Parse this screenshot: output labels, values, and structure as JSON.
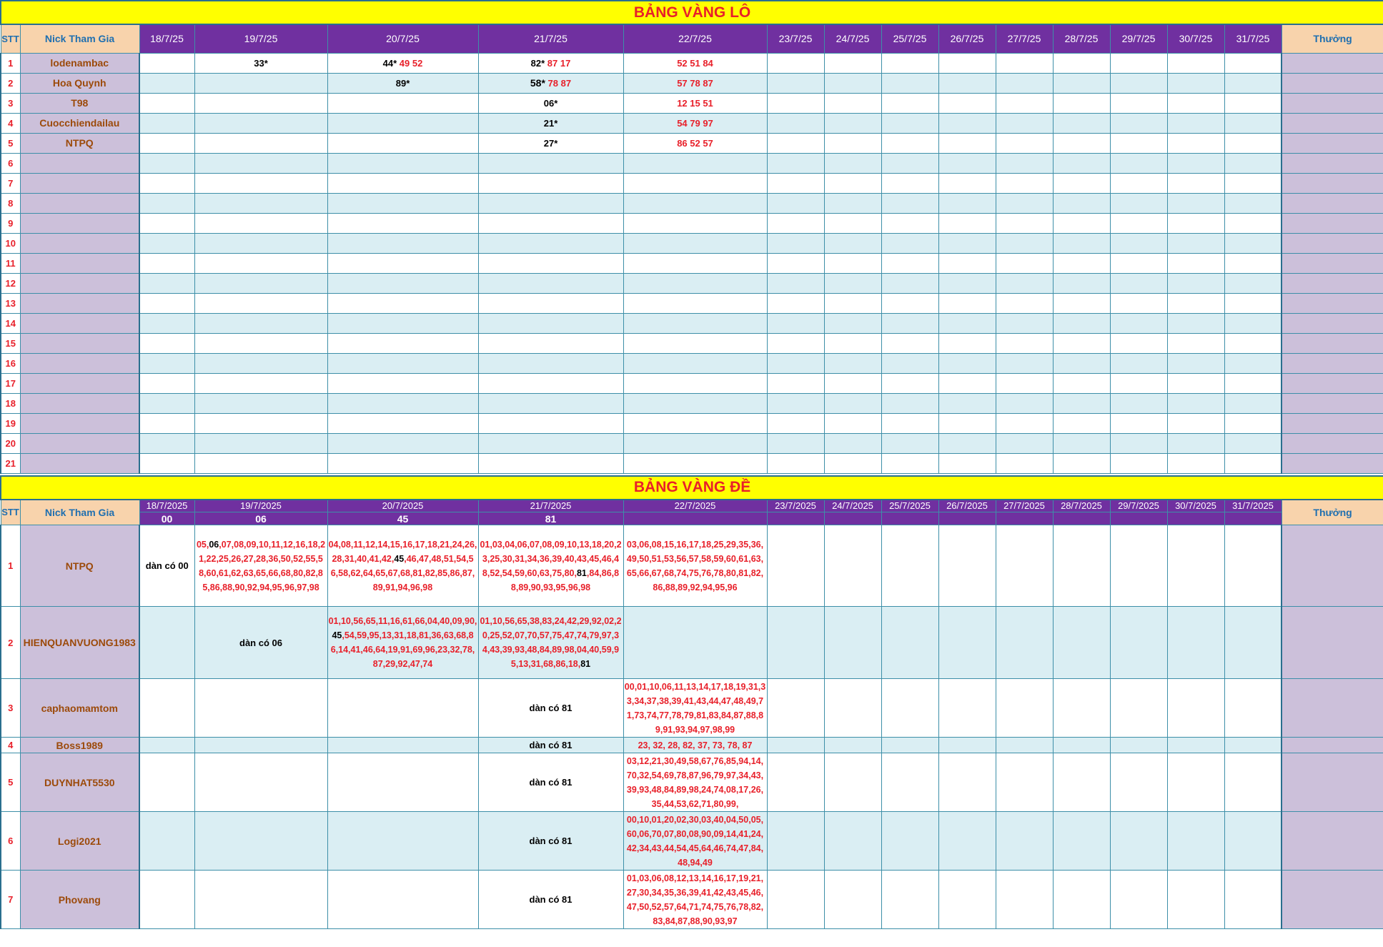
{
  "lo": {
    "title": "BẢNG VÀNG LÔ",
    "header": {
      "stt": "STT",
      "nick": "Nick Tham Gia",
      "thuong": "Thưởng",
      "dates": [
        "18/7/25",
        "19/7/25",
        "20/7/25",
        "21/7/25",
        "22/7/25",
        "23/7/25",
        "24/7/25",
        "25/7/25",
        "26/7/25",
        "27/7/25",
        "28/7/25",
        "29/7/25",
        "30/7/25",
        "31/7/25"
      ]
    },
    "rows": [
      {
        "stt": "1",
        "nick": "lodenambac",
        "cells": [
          {
            "b": "",
            "r": ""
          },
          {
            "b": "33*",
            "r": ""
          },
          {
            "b": "44*",
            "r": "49 52"
          },
          {
            "b": "82*",
            "r": "87 17"
          },
          {
            "b": "",
            "r": "52 51 84"
          }
        ]
      },
      {
        "stt": "2",
        "nick": "Hoa Quynh",
        "cells": [
          {
            "b": "",
            "r": ""
          },
          {
            "b": "",
            "r": ""
          },
          {
            "b": "89*",
            "r": ""
          },
          {
            "b": "58*",
            "r": "78 87"
          },
          {
            "b": "",
            "r": "57 78 87"
          }
        ]
      },
      {
        "stt": "3",
        "nick": "T98",
        "cells": [
          {
            "b": "",
            "r": ""
          },
          {
            "b": "",
            "r": ""
          },
          {
            "b": "",
            "r": ""
          },
          {
            "b": "06*",
            "r": ""
          },
          {
            "b": "",
            "r": "12 15 51"
          }
        ]
      },
      {
        "stt": "4",
        "nick": "Cuocchiendailau",
        "cells": [
          {
            "b": "",
            "r": ""
          },
          {
            "b": "",
            "r": ""
          },
          {
            "b": "",
            "r": ""
          },
          {
            "b": "21*",
            "r": ""
          },
          {
            "b": "",
            "r": "54 79 97"
          }
        ]
      },
      {
        "stt": "5",
        "nick": "NTPQ",
        "cells": [
          {
            "b": "",
            "r": ""
          },
          {
            "b": "",
            "r": ""
          },
          {
            "b": "",
            "r": ""
          },
          {
            "b": "27*",
            "r": ""
          },
          {
            "b": "",
            "r": "86 52 57"
          }
        ]
      },
      {
        "stt": "6",
        "nick": ""
      },
      {
        "stt": "7",
        "nick": ""
      },
      {
        "stt": "8",
        "nick": ""
      },
      {
        "stt": "9",
        "nick": ""
      },
      {
        "stt": "10",
        "nick": ""
      },
      {
        "stt": "11",
        "nick": ""
      },
      {
        "stt": "12",
        "nick": ""
      },
      {
        "stt": "13",
        "nick": ""
      },
      {
        "stt": "14",
        "nick": ""
      },
      {
        "stt": "15",
        "nick": ""
      },
      {
        "stt": "16",
        "nick": ""
      },
      {
        "stt": "17",
        "nick": ""
      },
      {
        "stt": "18",
        "nick": ""
      },
      {
        "stt": "19",
        "nick": ""
      },
      {
        "stt": "20",
        "nick": ""
      },
      {
        "stt": "21",
        "nick": ""
      }
    ]
  },
  "de": {
    "title": "BẢNG VÀNG ĐỀ",
    "header": {
      "stt": "STT",
      "nick": "Nick Tham Gia",
      "thuong": "Thưởng",
      "dates": [
        "18/7/2025",
        "19/7/2025",
        "20/7/2025",
        "21/7/2025",
        "22/7/2025",
        "23/7/2025",
        "24/7/2025",
        "25/7/2025",
        "26/7/2025",
        "27/7/2025",
        "28/7/2025",
        "29/7/2025",
        "30/7/2025",
        "31/7/2025"
      ],
      "results": [
        "00",
        "06",
        "45",
        "81",
        "",
        "",
        "",
        "",
        "",
        "",
        "",
        "",
        "",
        ""
      ]
    },
    "rows": [
      {
        "stt": "1",
        "nick": "NTPQ",
        "cells": [
          {
            "plain": "dàn có 00"
          },
          {
            "parts": [
              [
                "r",
                "05,"
              ],
              [
                "k",
                "06"
              ],
              [
                "r",
                ",07,08,09,10,11,12,16,18,21,22,25,26,27,28,36,50,52,55,58,60,61,62,63,65,66,68,80,82,85,86,88,90,92,94,95,96,97,98"
              ]
            ]
          },
          {
            "parts": [
              [
                "r",
                "04,08,11,12,14,15,16,17,18,21,24,26,28,31,40,41,42,"
              ],
              [
                "k",
                "45"
              ],
              [
                "r",
                ",46,47,48,51,54,56,58,62,64,65,67,68,81,82,85,86,87,89,91,94,96,98"
              ]
            ]
          },
          {
            "parts": [
              [
                "r",
                "01,03,04,06,07,08,09,10,13,18,20,23,25,30,31,34,36,39,40,43,45,46,48,52,54,59,60,63,75,80,"
              ],
              [
                "k",
                "81"
              ],
              [
                "r",
                ",84,86,88,89,90,93,95,96,98"
              ]
            ]
          },
          {
            "parts": [
              [
                "r",
                "03,06,08,15,16,17,18,25,29,35,36,49,50,51,53,56,57,58,59,60,61,63,65,66,67,68,74,75,76,78,80,81,82,86,88,89,92,94,95,96"
              ]
            ]
          }
        ]
      },
      {
        "stt": "2",
        "nick": "HIENQUANVUONG1983",
        "cells": [
          {
            "plain": ""
          },
          {
            "plain": "dàn có 06"
          },
          {
            "parts": [
              [
                "r",
                "01,10,56,65,11,16,61,66,04,40,09,90,"
              ],
              [
                "k",
                "45"
              ],
              [
                "r",
                ",54,59,95,13,31,18,81,36,63,68,86,14,41,46,64,19,91,69,96,23,32,78,87,29,92,47,74"
              ]
            ]
          },
          {
            "parts": [
              [
                "r",
                "01,10,56,65,38,83,24,42,29,92,02,20,25,52,07,70,57,75,47,74,79,97,34,43,39,93,48,84,89,98,04,40,59,95,13,31,68,86,18,"
              ],
              [
                "k",
                "81"
              ]
            ]
          },
          {
            "plain": ""
          }
        ]
      },
      {
        "stt": "3",
        "nick": "caphaomamtom",
        "cells": [
          {
            "plain": ""
          },
          {
            "plain": ""
          },
          {
            "plain": ""
          },
          {
            "plain": "dàn có 81"
          },
          {
            "parts": [
              [
                "r",
                "00,01,10,06,11,13,14,17,18,19,31,33,34,37,38,39,41,43,44,47,48,49,71,73,74,77,78,79,81,83,84,87,88,89,91,93,94,97,98,99"
              ]
            ]
          }
        ]
      },
      {
        "stt": "4",
        "nick": "Boss1989",
        "cells": [
          {
            "plain": ""
          },
          {
            "plain": ""
          },
          {
            "plain": ""
          },
          {
            "plain": "dàn có 81"
          },
          {
            "parts": [
              [
                "r",
                "23, 32, 28, 82, 37, 73, 78, 87"
              ]
            ]
          }
        ]
      },
      {
        "stt": "5",
        "nick": "DUYNHAT5530",
        "cells": [
          {
            "plain": ""
          },
          {
            "plain": ""
          },
          {
            "plain": ""
          },
          {
            "plain": "dàn có 81"
          },
          {
            "parts": [
              [
                "r",
                "03,12,21,30,49,58,67,76,85,94,14,70,32,54,69,78,87,96,79,97,34,43,39,93,48,84,89,98,24,74,08,17,26,35,44,53,62,71,80,99,"
              ]
            ]
          }
        ]
      },
      {
        "stt": "6",
        "nick": "Logi2021",
        "cells": [
          {
            "plain": ""
          },
          {
            "plain": ""
          },
          {
            "plain": ""
          },
          {
            "plain": "dàn có 81"
          },
          {
            "parts": [
              [
                "r",
                "00,10,01,20,02,30,03,40,04,50,05,60,06,70,07,80,08,90,09,14,41,24,42,34,43,44,54,45,64,46,74,47,84,48,94,49"
              ]
            ]
          }
        ]
      },
      {
        "stt": "7",
        "nick": "Phovang",
        "cells": [
          {
            "plain": ""
          },
          {
            "plain": ""
          },
          {
            "plain": ""
          },
          {
            "plain": "dàn có 81"
          },
          {
            "parts": [
              [
                "r",
                "01,03,06,08,12,13,14,16,17,19,21,27,30,34,35,36,39,41,42,43,45,46,47,50,52,57,64,71,74,75,76,78,82,83,84,87,88,90,93,97"
              ]
            ]
          }
        ]
      }
    ]
  }
}
